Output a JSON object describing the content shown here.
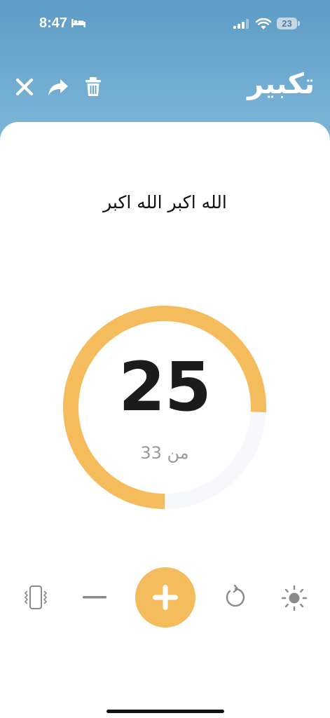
{
  "status_bar": {
    "time": "8:47",
    "battery_level": "23",
    "icons": [
      "bed-icon",
      "cellular-signal-icon",
      "wifi-icon",
      "battery-icon"
    ]
  },
  "header": {
    "title": "تكبير",
    "actions": [
      "close-icon",
      "share-icon",
      "trash-icon"
    ]
  },
  "dhikr": {
    "text": "الله اكبر الله اكبر"
  },
  "counter": {
    "current": "25",
    "total_label": "من 33",
    "progress_fraction": 0.7576
  },
  "controls": {
    "icons": [
      "vibrate-icon",
      "minus-icon",
      "plus-icon",
      "reset-icon",
      "brightness-icon"
    ]
  },
  "colors": {
    "accent": "#f4bc5c",
    "header_bg": "#6aa7cf",
    "track": "#f6f8fb",
    "text_dark": "#1c1c1c",
    "text_muted": "#9a9a9a",
    "icon_gray": "#8a8a8a"
  }
}
